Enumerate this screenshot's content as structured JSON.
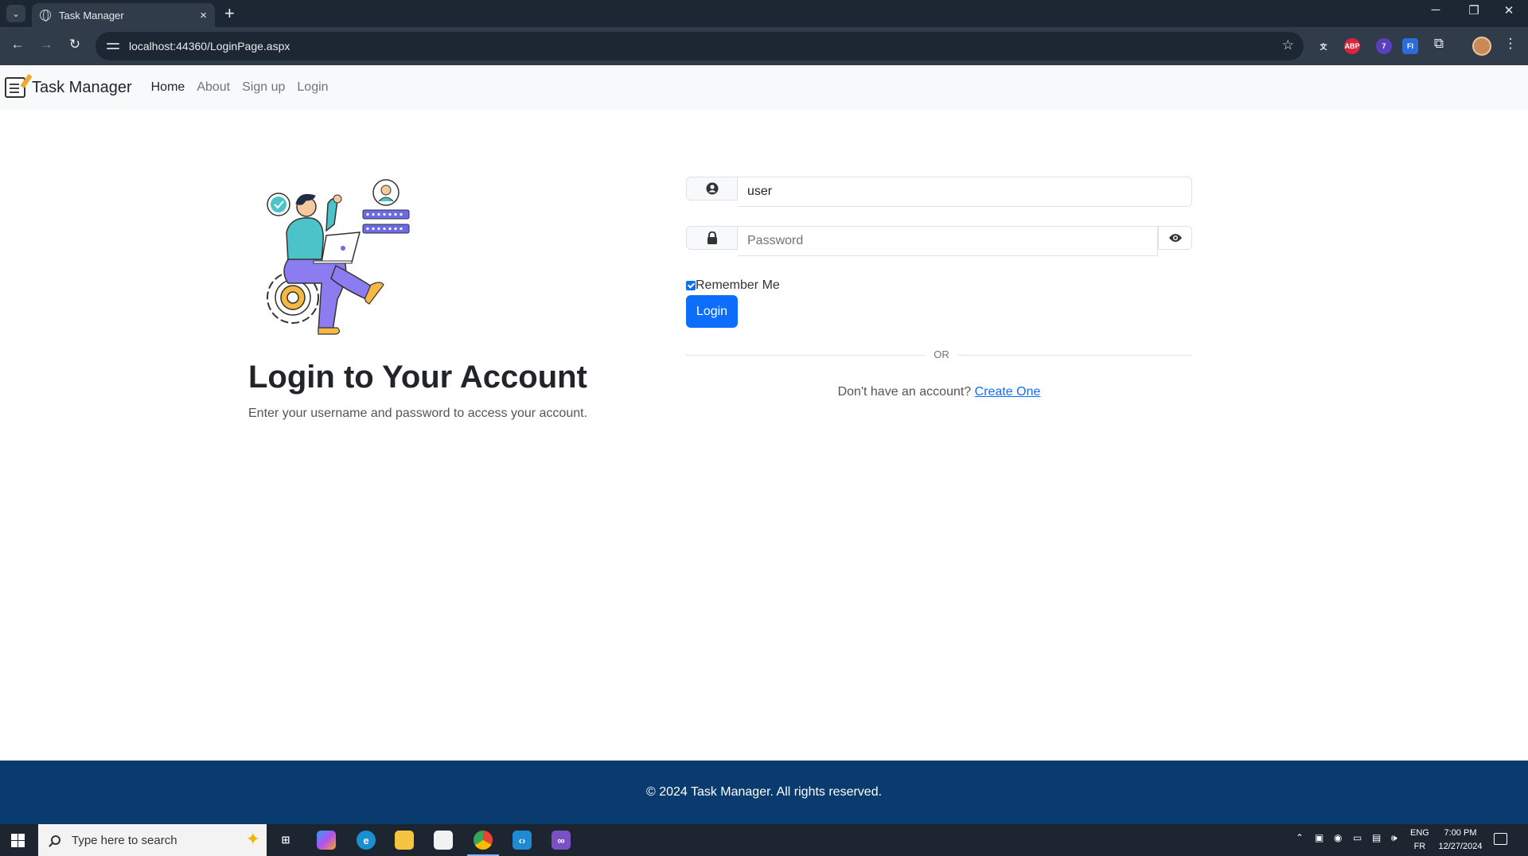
{
  "browser": {
    "tab_title": "Task Manager",
    "tab_close": "×",
    "new_tab": "+",
    "url": "localhost:44360/LoginPage.aspx",
    "window_controls": {
      "minimize": "─",
      "restore": "❐",
      "close": "✕"
    },
    "extensions": [
      {
        "name": "translate-icon",
        "label": "文",
        "color": "#303c49"
      },
      {
        "name": "adblock-icon",
        "label": "ABP",
        "color": "#d9263c"
      },
      {
        "name": "extension-badge-icon",
        "label": "7",
        "color": "#5a3fc0"
      },
      {
        "name": "fi-extension-icon",
        "label": "FI",
        "color": "#2b6cd6"
      }
    ]
  },
  "navbar": {
    "brand": "Task Manager",
    "links": [
      "Home",
      "About",
      "Sign up",
      "Login"
    ]
  },
  "hero": {
    "title": "Login to Your Account",
    "subtitle": "Enter your username and password to access your account."
  },
  "form": {
    "username_value": "user",
    "password_placeholder": "Password",
    "remember_label": "Remember Me",
    "remember_checked": true,
    "login_button": "Login",
    "divider_text": "OR",
    "signup_prompt": "Don't have an account?",
    "signup_link": "Create One"
  },
  "footer": {
    "text": "© 2024 Task Manager. All rights reserved."
  },
  "taskbar": {
    "search_placeholder": "Type here to search",
    "language_top": "ENG",
    "language_bottom": "FR",
    "time": "7:00 PM",
    "date": "12/27/2024"
  },
  "colors": {
    "primary": "#0d6efd",
    "footer": "#0a3b6e",
    "navbar_bg": "#f8f9fa"
  }
}
